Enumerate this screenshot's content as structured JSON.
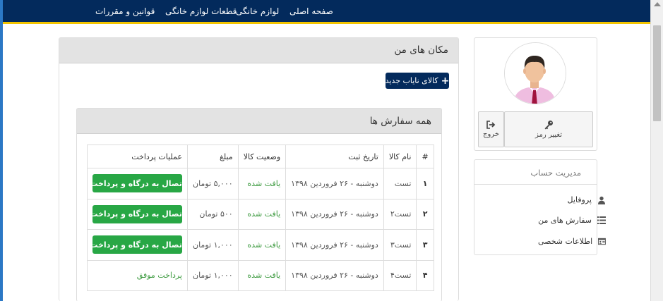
{
  "nav": {
    "items": [
      "صفحه اصلی",
      "لوازم خانگی",
      "قطعات لوازم خانگی",
      "قوانین و مقررات"
    ]
  },
  "main": {
    "title": "مکان های من",
    "new_button": "کالای نایاب جدید",
    "orders": {
      "title": "همه سفارش ها",
      "headers": [
        "#",
        "نام کالا",
        "تاریخ ثبت",
        "وضعیت کالا",
        "مبلغ",
        "عملیات پرداخت"
      ],
      "rows": [
        {
          "num": "۱",
          "name": "تست",
          "date": "دوشنبه - ۲۶ فروردین ۱۳۹۸",
          "status": "یافت شده",
          "amount": "۵,۰۰۰ تومان",
          "action": "اتصال به درگاه و پرداخت"
        },
        {
          "num": "۲",
          "name": "تست۲",
          "date": "دوشنبه - ۲۶ فروردین ۱۳۹۸",
          "status": "یافت شده",
          "amount": "۵۰۰ تومان",
          "action": "اتصال به درگاه و پرداخت"
        },
        {
          "num": "۳",
          "name": "تست۳",
          "date": "دوشنبه - ۲۶ فروردین ۱۳۹۸",
          "status": "یافت شده",
          "amount": "۱,۰۰۰ تومان",
          "action": "اتصال به درگاه و پرداخت"
        },
        {
          "num": "۴",
          "name": "تست۴",
          "date": "دوشنبه - ۲۶ فروردین ۱۳۹۸",
          "status": "یافت شده",
          "amount": "۱,۰۰۰ تومان",
          "action_text": "پرداخت موفق"
        }
      ]
    }
  },
  "sidebar": {
    "change_password": "تغییر رمز",
    "logout": "خروج",
    "account": {
      "title": "مدیریت حساب",
      "items": [
        "پروفایل",
        "سفارش های من",
        "اطلاعات شخصی"
      ]
    }
  },
  "colors": {
    "navbar": "#032a5c",
    "accent_line": "#f2c400",
    "pay_button": "#28a745",
    "status_text": "#3c9a3f"
  },
  "icons": [
    "plus-icon",
    "key-icon",
    "sign-out-icon",
    "user-icon",
    "list-icon",
    "id-card-icon"
  ]
}
